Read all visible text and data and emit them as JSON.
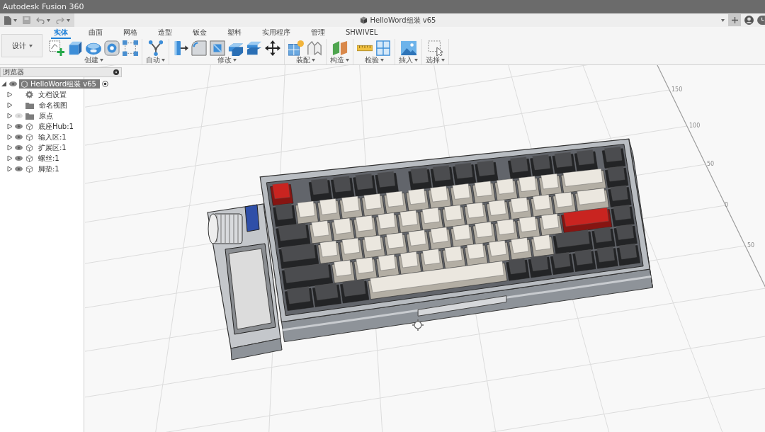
{
  "window": {
    "title": "Autodesk Fusion 360"
  },
  "document_tab": {
    "title": "HelloWord组装 v65"
  },
  "workspace": {
    "label": "设计"
  },
  "ribbon_tabs": [
    {
      "label": "实体",
      "selected": true
    },
    {
      "label": "曲面",
      "selected": false
    },
    {
      "label": "网格",
      "selected": false
    },
    {
      "label": "造型",
      "selected": false
    },
    {
      "label": "钣金",
      "selected": false
    },
    {
      "label": "塑料",
      "selected": false
    },
    {
      "label": "实用程序",
      "selected": false
    },
    {
      "label": "管理",
      "selected": false
    },
    {
      "label": "SHWIVEL",
      "selected": false
    }
  ],
  "ribbon_groups": [
    {
      "label": "创建",
      "tools": [
        {
          "kind": "sketch"
        },
        {
          "kind": "extrude"
        },
        {
          "kind": "revolve"
        },
        {
          "kind": "hole"
        },
        {
          "kind": "pattern"
        }
      ]
    },
    {
      "label": "自动",
      "tools": [
        {
          "kind": "automate"
        }
      ]
    },
    {
      "label": "修改",
      "tools": [
        {
          "kind": "presspull"
        },
        {
          "kind": "fillet"
        },
        {
          "kind": "shell"
        },
        {
          "kind": "combine"
        },
        {
          "kind": "split"
        },
        {
          "kind": "move"
        }
      ]
    },
    {
      "label": "装配",
      "tools": [
        {
          "kind": "component"
        },
        {
          "kind": "joint"
        }
      ]
    },
    {
      "label": "构造",
      "tools": [
        {
          "kind": "plane"
        }
      ]
    },
    {
      "label": "检验",
      "tools": [
        {
          "kind": "measure"
        },
        {
          "kind": "section"
        }
      ]
    },
    {
      "label": "插入",
      "tools": [
        {
          "kind": "image"
        }
      ]
    },
    {
      "label": "选择",
      "tools": [
        {
          "kind": "select"
        }
      ]
    }
  ],
  "browser": {
    "title": "浏览器",
    "root": {
      "label": "HelloWord组装 v65",
      "expanded": true,
      "active": true,
      "children": [
        {
          "label": "文档设置",
          "kind": "settings",
          "expanded": false
        },
        {
          "label": "命名视图",
          "kind": "views",
          "expanded": false
        },
        {
          "label": "原点",
          "kind": "origin",
          "visible": false,
          "expanded": false
        },
        {
          "label": "底座Hub:1",
          "kind": "component",
          "visible": true,
          "expanded": false
        },
        {
          "label": "输入区:1",
          "kind": "component",
          "visible": true,
          "expanded": false
        },
        {
          "label": "扩展区:1",
          "kind": "component",
          "visible": true,
          "expanded": false
        },
        {
          "label": "螺丝:1",
          "kind": "component",
          "visible": true,
          "expanded": false
        },
        {
          "label": "脚垫:1",
          "kind": "component",
          "visible": true,
          "expanded": false
        }
      ]
    }
  },
  "viewport": {
    "axis_labels": [
      "150",
      "100",
      "50",
      "0",
      "50"
    ]
  }
}
